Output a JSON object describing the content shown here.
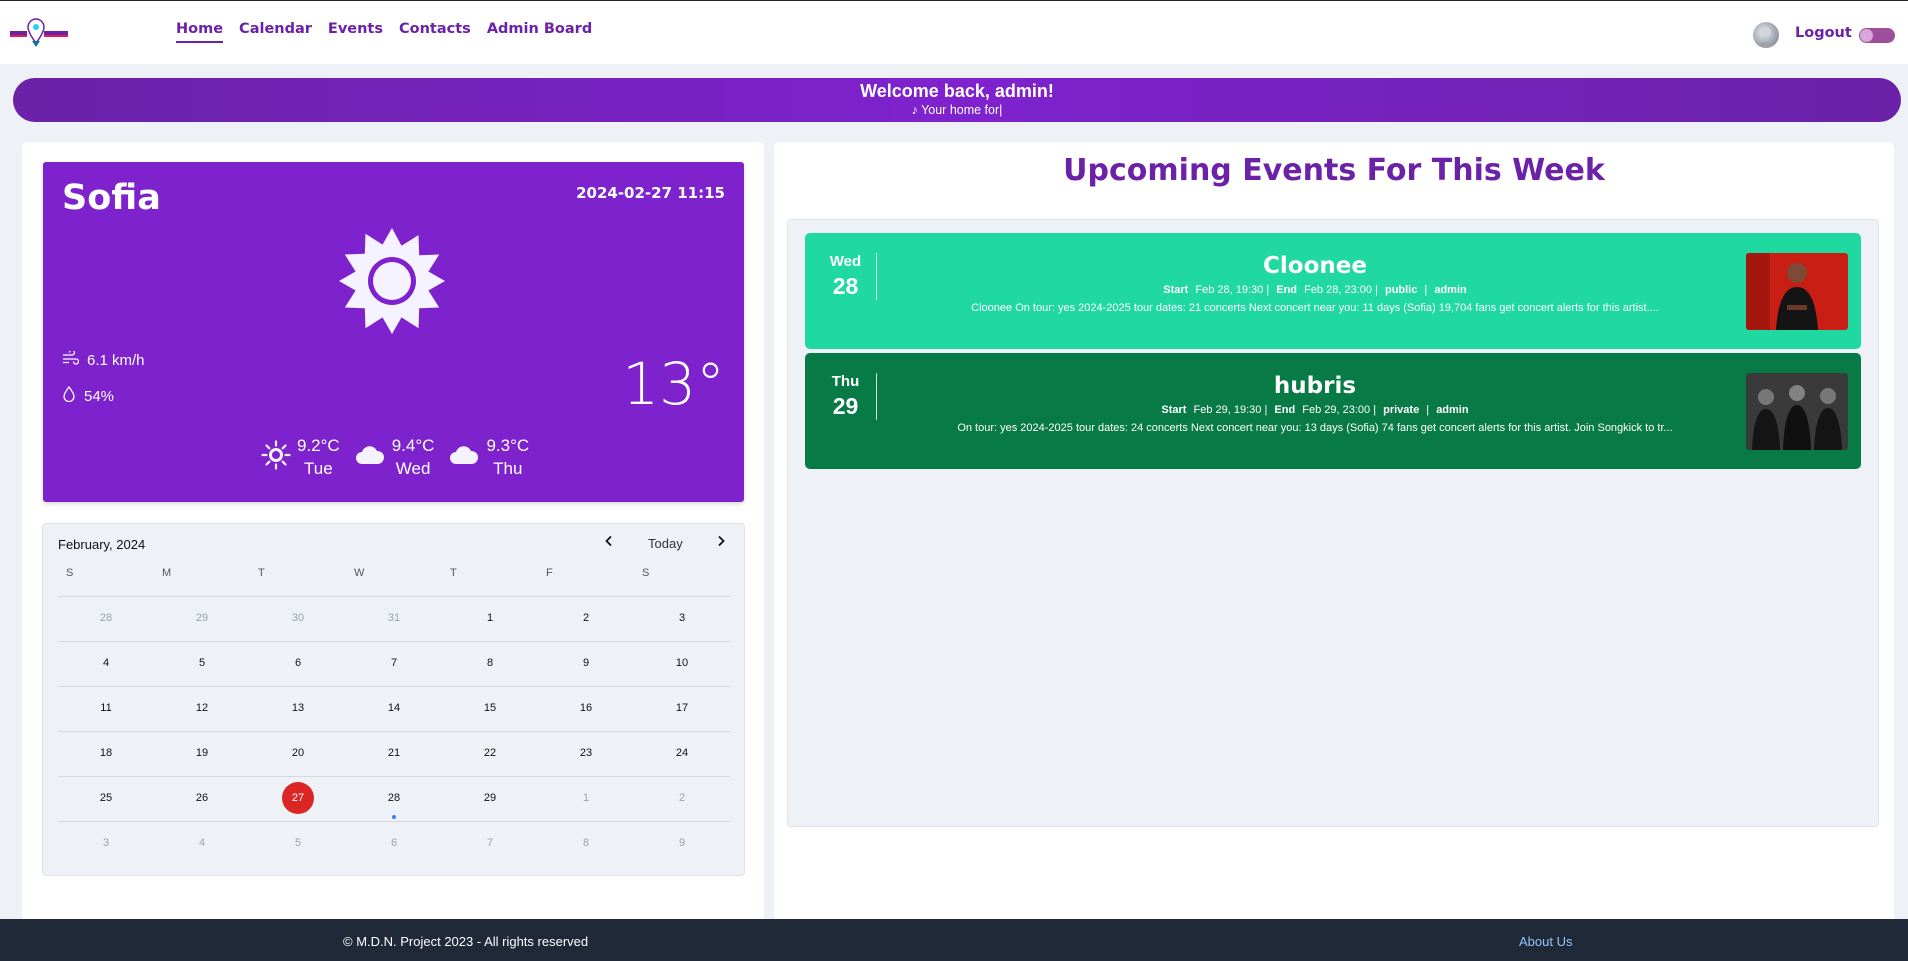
{
  "colors": {
    "brand": "#6b21a8",
    "weather_bg": "#7e22ce",
    "event_public": "#20d9a1",
    "event_private": "#077a45",
    "today": "#dc2626",
    "footer": "#1f2937"
  },
  "nav": {
    "links": [
      {
        "label": "Home",
        "active": true
      },
      {
        "label": "Calendar",
        "active": false
      },
      {
        "label": "Events",
        "active": false
      },
      {
        "label": "Contacts",
        "active": false
      },
      {
        "label": "Admin Board",
        "active": false
      }
    ],
    "logout_label": "Logout"
  },
  "banner": {
    "title": "Welcome back, admin!",
    "subtitle": "♪ Your home for|"
  },
  "weather": {
    "city": "Sofia",
    "datetime": "2024-02-27 11:15",
    "condition_icon": "sun-icon",
    "wind": "6.1 km/h",
    "humidity": "54%",
    "temperature": "13°",
    "forecast": [
      {
        "temp": "9.2°C",
        "day": "Tue",
        "icon": "sun-icon"
      },
      {
        "temp": "9.4°C",
        "day": "Wed",
        "icon": "cloud-icon"
      },
      {
        "temp": "9.3°C",
        "day": "Thu",
        "icon": "cloud-icon"
      }
    ]
  },
  "calendar": {
    "month_label": "February, 2024",
    "today_label": "Today",
    "weekdays": [
      "S",
      "M",
      "T",
      "W",
      "T",
      "F",
      "S"
    ],
    "weeks": [
      [
        "28",
        "29",
        "30",
        "31",
        "1",
        "2",
        "3"
      ],
      [
        "4",
        "5",
        "6",
        "7",
        "8",
        "9",
        "10"
      ],
      [
        "11",
        "12",
        "13",
        "14",
        "15",
        "16",
        "17"
      ],
      [
        "18",
        "19",
        "20",
        "21",
        "22",
        "23",
        "24"
      ],
      [
        "25",
        "26",
        "27",
        "28",
        "29",
        "1",
        "2"
      ],
      [
        "3",
        "4",
        "5",
        "6",
        "7",
        "8",
        "9"
      ]
    ],
    "today": "27"
  },
  "events": {
    "title": "Upcoming Events For This Week",
    "items": [
      {
        "dow": "Wed",
        "day": "28",
        "name": "Cloonee",
        "start_label": "Start",
        "start": "Feb 28, 19:30 |",
        "end_label": "End",
        "end": "Feb 28, 23:00 |",
        "visibility": "public",
        "separator": "|",
        "owner": "admin",
        "description": "Cloonee On tour: yes 2024-2025 tour dates: 21 concerts Next concert near you: 11 days (Sofia) 19,704 fans get concert alerts for this artist...."
      },
      {
        "dow": "Thu",
        "day": "29",
        "name": "hubris",
        "start_label": "Start",
        "start": "Feb 29, 19:30 |",
        "end_label": "End",
        "end": "Feb 29, 23:00 |",
        "visibility": "private",
        "separator": "|",
        "owner": "admin",
        "description": "On tour: yes 2024-2025 tour dates: 24 concerts Next concert near you: 13 days (Sofia) 74 fans get concert alerts for this artist. Join Songkick to tr..."
      }
    ]
  },
  "footer": {
    "copyright": "© M.D.N. Project 2023 - All rights reserved",
    "about": "About Us"
  }
}
